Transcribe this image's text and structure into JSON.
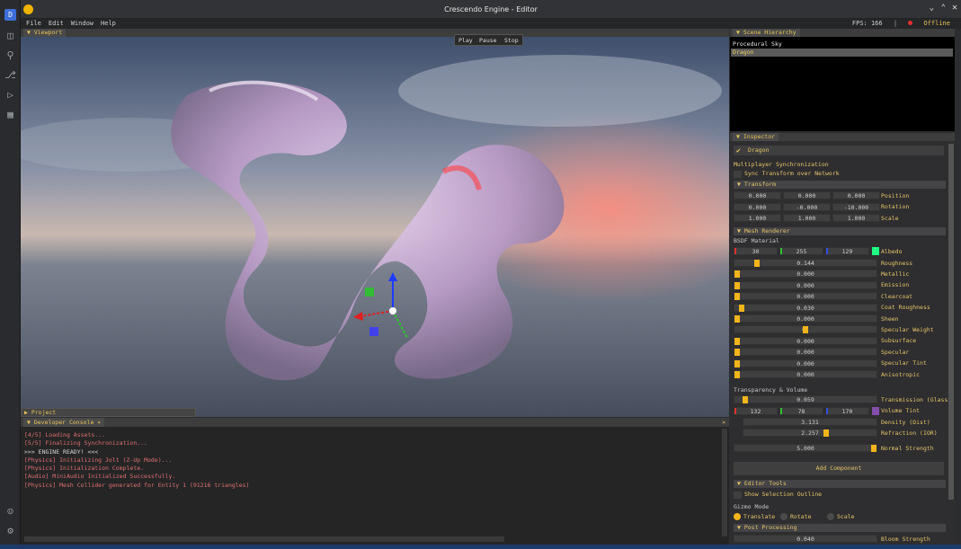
{
  "window": {
    "title": "Crescendo Engine - Editor"
  },
  "menu": [
    "File",
    "Edit",
    "Window",
    "Help"
  ],
  "status": {
    "fps_label": "FPS: 166",
    "separator": "|",
    "net": "Offline"
  },
  "viewport": {
    "tab": "Viewport"
  },
  "playbar": {
    "play": "Play",
    "pause": "Pause",
    "stop": "Stop"
  },
  "project": {
    "tab": "Project"
  },
  "console": {
    "tab": "Developer Console",
    "close": "×",
    "lines": [
      {
        "text": "[4/5] Loading Assets...",
        "color": "#e07070"
      },
      {
        "text": "[5/5] Finalizing Synchronization...",
        "color": "#e07070"
      },
      {
        "text": ">>> ENGINE READY! <<<",
        "color": "#d8d8d8"
      },
      {
        "text": "[Physics] Initializing Jolt (Z-Up Mode)...",
        "color": "#e07070"
      },
      {
        "text": "[Physics] Initialization Complete.",
        "color": "#e07070"
      },
      {
        "text": "[Audio] MiniAudio Initialized Successfully.",
        "color": "#e07070"
      },
      {
        "text": "[Physics] Mesh Collider generated for Entity 1 (91216 triangles)",
        "color": "#e07070"
      }
    ]
  },
  "hierarchy": {
    "tab": "Scene Hierarchy",
    "items": [
      "Procedural Sky",
      "Dragon"
    ],
    "selected": 1
  },
  "inspector": {
    "tab": "Inspector",
    "name": "Dragon",
    "mp_title": "Multiplayer Synchronization",
    "mp_sync": "Sync Transform over Network",
    "transform": {
      "header": "Transform",
      "rows": [
        {
          "label": "Position",
          "vals": [
            "0.000",
            "0.000",
            "0.000"
          ]
        },
        {
          "label": "Rotation",
          "vals": [
            "0.000",
            "-0.000",
            "-10.000"
          ]
        },
        {
          "label": "Scale",
          "vals": [
            "1.000",
            "1.000",
            "1.000"
          ]
        }
      ]
    },
    "mesh": {
      "header": "Mesh Renderer",
      "bsdf": "BSDF Material",
      "albedo": {
        "label": "Albedo",
        "vals": [
          "30",
          "255",
          "129"
        ],
        "swatch": "#1eff81"
      },
      "sliders": [
        {
          "label": "Roughness",
          "val": "0.144",
          "level": 0.144
        },
        {
          "label": "Metallic",
          "val": "0.000",
          "level": 0.0
        },
        {
          "label": "Emission",
          "val": "0.000",
          "level": 0.0
        },
        {
          "label": "Clearcoat",
          "val": "0.000",
          "level": 0.0
        },
        {
          "label": "Coat Roughness",
          "val": "0.030",
          "level": 0.03
        },
        {
          "label": "Sheen",
          "val": "0.000",
          "level": 0.0
        },
        {
          "label": "Specular Weight",
          "val": "0.",
          "level": 0.5
        },
        {
          "label": "Subsurface",
          "val": "0.000",
          "level": 0.0
        },
        {
          "label": "Specular",
          "val": "0.000",
          "level": 0.0
        },
        {
          "label": "Specular Tint",
          "val": "0.000",
          "level": 0.0
        },
        {
          "label": "Anisotropic",
          "val": "0.000",
          "level": 0.0
        }
      ]
    },
    "tv": {
      "header": "Transparency & Volume",
      "transmission": {
        "label": "Transmission (Glass)",
        "val": "0.059",
        "level": 0.059
      },
      "tint": {
        "label": "Volume Tint",
        "vals": [
          "132",
          "78",
          "170"
        ],
        "swatch": "#844eaa"
      },
      "density": {
        "label": "Density (Dist)",
        "val": "3.131"
      },
      "refraction": {
        "label": "Refraction (IOR)",
        "val": "2.257",
        "level": 0.63
      },
      "normal": {
        "label": "Normal Strength",
        "val": "5.000",
        "level": 1.0
      }
    },
    "add_component": "Add Component",
    "editor_tools": {
      "header": "Editor Tools",
      "show_outline": "Show Selection Outline"
    },
    "gizmo": {
      "title": "Gizmo Mode",
      "options": [
        "Translate",
        "Rotate",
        "Scale"
      ],
      "selected": 0
    },
    "post": {
      "header": "Post Processing",
      "bloom": {
        "label": "Bloom Strength",
        "val": "0.040"
      }
    }
  },
  "colors": {
    "accent": "#e6c469",
    "knob": "#f3b51b",
    "fps": "#5ed35e",
    "offline": "#e03030"
  }
}
